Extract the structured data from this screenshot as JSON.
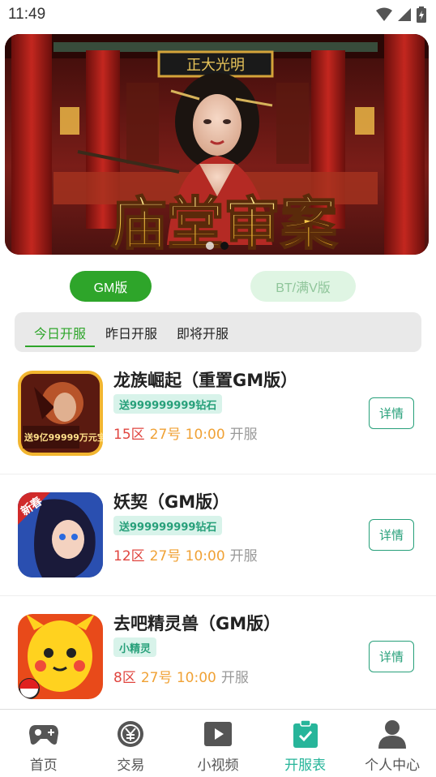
{
  "status_bar": {
    "time": "11:49"
  },
  "banner": {
    "plaque_text": "正大光明",
    "title_text": "庙堂审案",
    "dots": 2,
    "active_dot": 1
  },
  "version_tabs": {
    "gm": "GM版",
    "bt": "BT/满V版",
    "selected": "gm"
  },
  "date_tabs": [
    {
      "label": "今日开服",
      "active": true
    },
    {
      "label": "昨日开服",
      "active": false
    },
    {
      "label": "即将开服",
      "active": false
    }
  ],
  "games": [
    {
      "title": "龙族崛起（重置GM版）",
      "tag": "送999999999钻石",
      "zone": "15区",
      "time": "27号 10:00",
      "open_label": "开服",
      "detail_label": "详情",
      "icon": "dragon-warrior-icon",
      "icon_badge": "送9亿99999万元宝"
    },
    {
      "title": "妖契（GM版）",
      "tag": "送999999999钻石",
      "zone": "12区",
      "time": "27号 10:00",
      "open_label": "开服",
      "detail_label": "详情",
      "icon": "anime-girl-icon",
      "icon_badge": "新春"
    },
    {
      "title": "去吧精灵兽（GM版）",
      "tag": "小精灵",
      "zone": "8区",
      "time": "27号 10:00",
      "open_label": "开服",
      "detail_label": "详情",
      "icon": "yellow-monster-icon",
      "icon_badge": ""
    }
  ],
  "bottom_nav": [
    {
      "label": "首页",
      "icon": "gamepad-icon",
      "active": false
    },
    {
      "label": "交易",
      "icon": "yuan-coin-icon",
      "active": false
    },
    {
      "label": "小视频",
      "icon": "video-play-icon",
      "active": false
    },
    {
      "label": "开服表",
      "icon": "clipboard-check-icon",
      "active": true
    },
    {
      "label": "个人中心",
      "icon": "user-icon",
      "active": false
    }
  ],
  "colors": {
    "brand_green": "#2ea52a",
    "teal": "#27a07a",
    "nav_active": "#27b59a",
    "zone_red": "#e0453f",
    "time_orange": "#f0a236"
  }
}
